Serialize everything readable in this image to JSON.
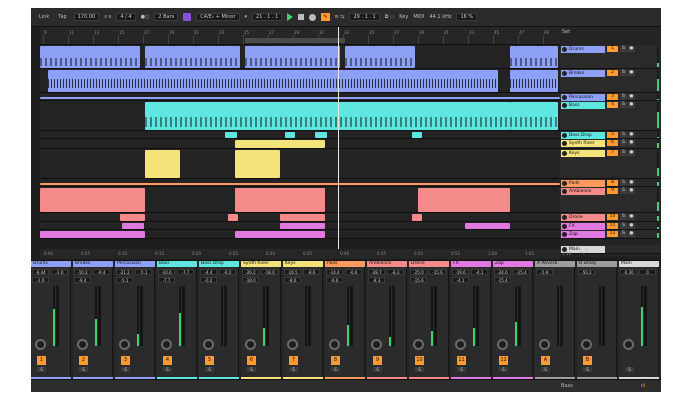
{
  "topbar": {
    "link": "Link",
    "tap": "Tap",
    "tempo": "170.00",
    "signature": "4 / 4",
    "quantize": "2 Bars",
    "key": "C4/E♭ + Minor",
    "position": "21 . 1 . 1",
    "position2": "29 . 1 . 1",
    "key_label": "Key",
    "midi_label": "MIDI",
    "sample_rate": "44.1 kHz",
    "cpu": "16 %"
  },
  "ruler": {
    "ticks": [
      "9",
      "11",
      "13",
      "15",
      "17",
      "19",
      "21",
      "23",
      "25",
      "27",
      "29",
      "31",
      "33",
      "35",
      "37",
      "39",
      "41",
      "43",
      "45",
      "47",
      "49"
    ],
    "set_label": "Set"
  },
  "tracks": [
    {
      "name": "Drums",
      "num": "1",
      "color": "#8ea0f5"
    },
    {
      "name": "Breaks",
      "num": "2",
      "color": "#8ea0f5"
    },
    {
      "name": "Percussion",
      "num": "3",
      "color": "#8ea0f5"
    },
    {
      "name": "Bass",
      "num": "4",
      "color": "#5fe6e0"
    },
    {
      "name": "Bass Drop",
      "num": "5",
      "color": "#5fe6e0"
    },
    {
      "name": "Synth Riser",
      "num": "6",
      "color": "#f4e27a"
    },
    {
      "name": "Keys",
      "num": "7",
      "color": "#f4e27a"
    },
    {
      "name": "Pads",
      "num": "8",
      "color": "#ff9a5e"
    },
    {
      "name": "Ambience",
      "num": "9",
      "color": "#f58a8a"
    },
    {
      "name": "Drone",
      "num": "10",
      "color": "#f58a8a"
    },
    {
      "name": "FX",
      "num": "11",
      "color": "#e07ae0"
    },
    {
      "name": "Zap",
      "num": "12",
      "color": "#e07ae0"
    }
  ],
  "main_track": "Main",
  "timeline": {
    "ticks": [
      "0:00",
      "0:05",
      "0:10",
      "0:15",
      "0:20",
      "0:25",
      "0:30",
      "0:35",
      "0:40",
      "0:45",
      "0:50",
      "0:55",
      "1:00",
      "1:05",
      "1:10"
    ],
    "page": "1/2"
  },
  "mixer": {
    "strips": [
      {
        "name": "Drums",
        "vol": "-6.44",
        "peak": "-1.0",
        "vol2": "-1.0",
        "num": "1",
        "color": "#8ea0f5",
        "level": 0.62
      },
      {
        "name": "Breaks",
        "vol": "-10.2",
        "peak": "-9.4",
        "vol2": "-9.4",
        "num": "2",
        "color": "#8ea0f5",
        "level": 0.45
      },
      {
        "name": "Percussion",
        "vol": "-21.2",
        "peak": "-5.1",
        "vol2": "-5.1",
        "num": "3",
        "color": "#8ea0f5",
        "level": 0.2
      },
      {
        "name": "Bass",
        "vol": "-10.6",
        "peak": "-7.7",
        "vol2": "-7.7",
        "num": "4",
        "color": "#5fe6e0",
        "level": 0.55
      },
      {
        "name": "Bass Drop",
        "vol": "-4.4",
        "peak": "-0.2",
        "vol2": "-0.2",
        "num": "5",
        "color": "#5fe6e0",
        "level": 0.0
      },
      {
        "name": "Synth Riser",
        "vol": "-26.2",
        "peak": "-18.0",
        "vol2": "-18.0",
        "num": "6",
        "color": "#f4e27a",
        "level": 0.3
      },
      {
        "name": "Keys",
        "vol": "-16.5",
        "peak": "-8.6",
        "vol2": "-8.6",
        "num": "7",
        "color": "#f4e27a",
        "level": 0.0
      },
      {
        "name": "Pads",
        "vol": "-14.4",
        "peak": "-6.6",
        "vol2": "-6.6",
        "num": "8",
        "color": "#ff9a5e",
        "level": 0.35
      },
      {
        "name": "Ambience",
        "vol": "-28.7",
        "peak": "-8.3",
        "vol2": "-8.3",
        "num": "9",
        "color": "#f58a8a",
        "level": 0.15
      },
      {
        "name": "Drone",
        "vol": "-25.0",
        "peak": "-15.6",
        "vol2": "-15.6",
        "num": "10",
        "color": "#f58a8a",
        "level": 0.25
      },
      {
        "name": "FX",
        "vol": "-19.6",
        "peak": "-4.1",
        "vol2": "-4.1",
        "num": "11",
        "color": "#e07ae0",
        "level": 0.3
      },
      {
        "name": "Zap",
        "vol": "-24.6",
        "peak": "-15.4",
        "vol2": "-15.4",
        "num": "12",
        "color": "#e07ae0",
        "level": 0.4
      },
      {
        "name": "A Reverb",
        "vol": "-5.9",
        "peak": "",
        "vol2": "",
        "num": "A",
        "color": "#9d9d9d",
        "level": 0.0
      },
      {
        "name": "B Delay",
        "vol": "-50.2",
        "peak": "",
        "vol2": "",
        "num": "B",
        "color": "#9d9d9d",
        "level": 0.0
      },
      {
        "name": "Main",
        "vol": "-0.30",
        "peak": "0",
        "vol2": "",
        "num": "",
        "color": "#d8d8d8",
        "level": 0.65
      }
    ]
  },
  "statusbar": {
    "track_label": "Bass"
  },
  "colors": {
    "accent": "#ff9a2e",
    "meter": "#3fd26a",
    "background": "#1e1e1e"
  }
}
